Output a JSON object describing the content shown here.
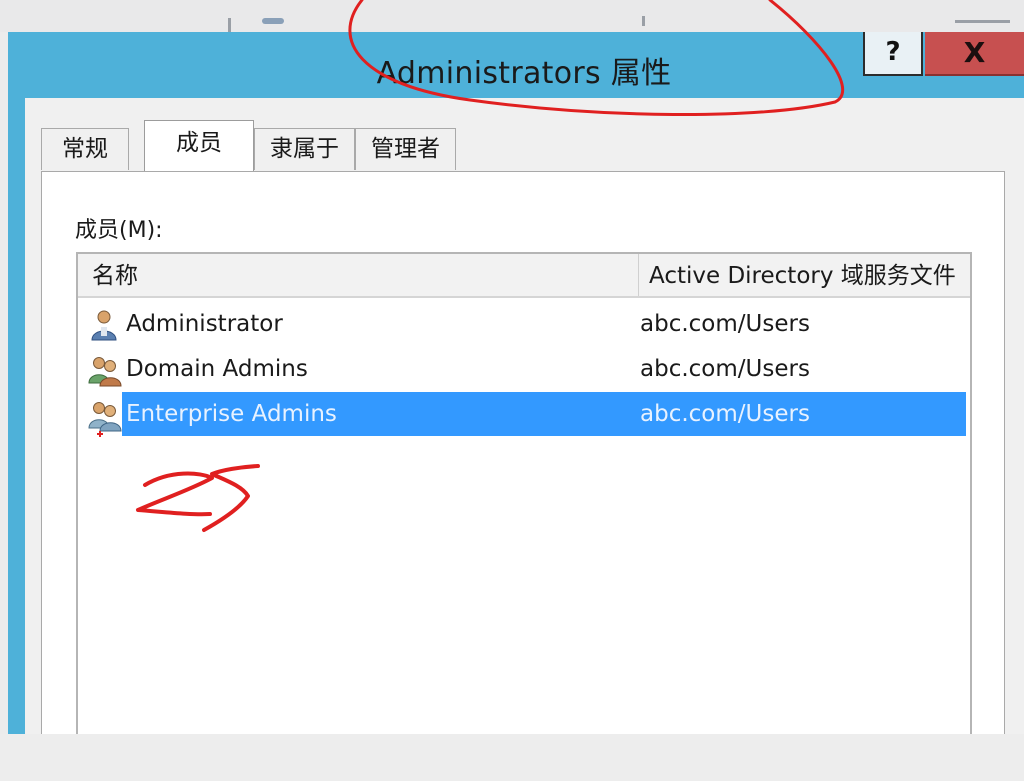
{
  "window": {
    "title": "Administrators 属性",
    "help_label": "?",
    "close_label": "X"
  },
  "tabs": [
    {
      "label": "常规",
      "active": false
    },
    {
      "label": "成员",
      "active": true
    },
    {
      "label": "隶属于",
      "active": false
    },
    {
      "label": "管理者",
      "active": false
    }
  ],
  "members": {
    "label": "成员(M):",
    "columns": [
      "名称",
      "Active Directory 域服务文件"
    ],
    "rows": [
      {
        "name": "Administrator",
        "folder": "abc.com/Users",
        "icon": "user-icon",
        "selected": false
      },
      {
        "name": "Domain Admins",
        "folder": "abc.com/Users",
        "icon": "group-icon",
        "selected": false
      },
      {
        "name": "Enterprise Admins",
        "folder": "abc.com/Users",
        "icon": "group-icon",
        "selected": true
      }
    ]
  },
  "colors": {
    "titlebar": "#4eb1d9",
    "close_button": "#c75050",
    "selection": "#3399ff",
    "annotation_ink": "#e02020"
  }
}
